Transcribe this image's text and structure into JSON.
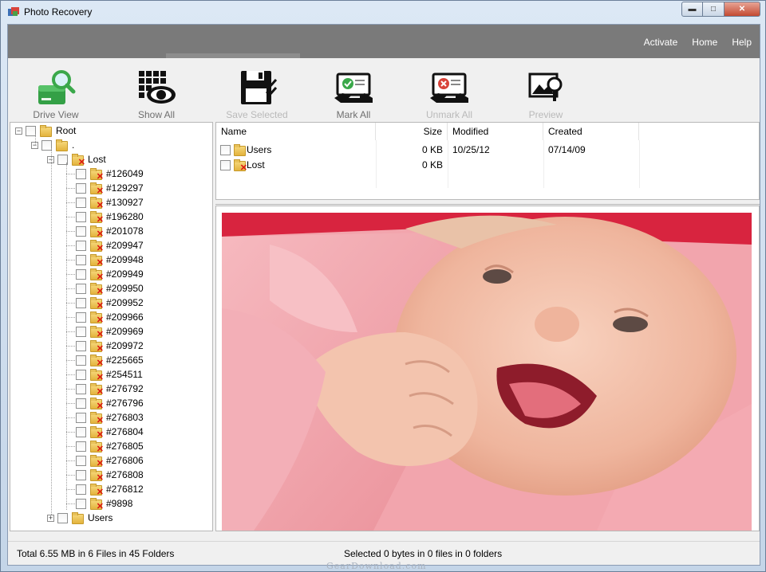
{
  "window": {
    "title": "Photo Recovery",
    "controls": [
      "minimize",
      "maximize",
      "close"
    ]
  },
  "menu": {
    "items": [
      "Activate",
      "Home",
      "Help"
    ]
  },
  "toolbar": {
    "items": [
      {
        "label": "Drive View",
        "icon": "drive-search-icon",
        "enabled": true
      },
      {
        "label": "Show All",
        "icon": "grid-eye-icon",
        "enabled": true
      },
      {
        "label": "Save Selected",
        "icon": "floppy-check-icon",
        "enabled": false
      },
      {
        "label": "Mark All",
        "icon": "hand-check-icon",
        "enabled": true
      },
      {
        "label": "Unmark All",
        "icon": "hand-cross-icon",
        "enabled": false
      },
      {
        "label": "Preview",
        "icon": "image-magnifier-icon",
        "enabled": false
      }
    ]
  },
  "tree": {
    "root": "Root",
    "dot": ".",
    "lost": "Lost",
    "lost_items": [
      "#126049",
      "#129297",
      "#130927",
      "#196280",
      "#201078",
      "#209947",
      "#209948",
      "#209949",
      "#209950",
      "#209952",
      "#209966",
      "#209969",
      "#209972",
      "#225665",
      "#254511",
      "#276792",
      "#276796",
      "#276803",
      "#276804",
      "#276805",
      "#276806",
      "#276808",
      "#276812",
      "#9898"
    ],
    "users": "Users"
  },
  "filelist": {
    "columns": [
      "Name",
      "Size",
      "Modified",
      "Created"
    ],
    "rows": [
      {
        "name": "Users",
        "size": "0 KB",
        "modified": "10/25/12",
        "created": "07/14/09"
      },
      {
        "name": "Lost",
        "size": "0 KB",
        "modified": "",
        "created": ""
      }
    ]
  },
  "status": {
    "total": "Total 6.55 MB in 6 Files in 45 Folders",
    "selected": "Selected 0 bytes in 0 files in 0 folders"
  },
  "watermark": "GearDownload.com",
  "colors": {
    "menubar": "#7a7a7a",
    "accent_green": "#3aa84a",
    "deleted_mark": "#dd1111"
  }
}
